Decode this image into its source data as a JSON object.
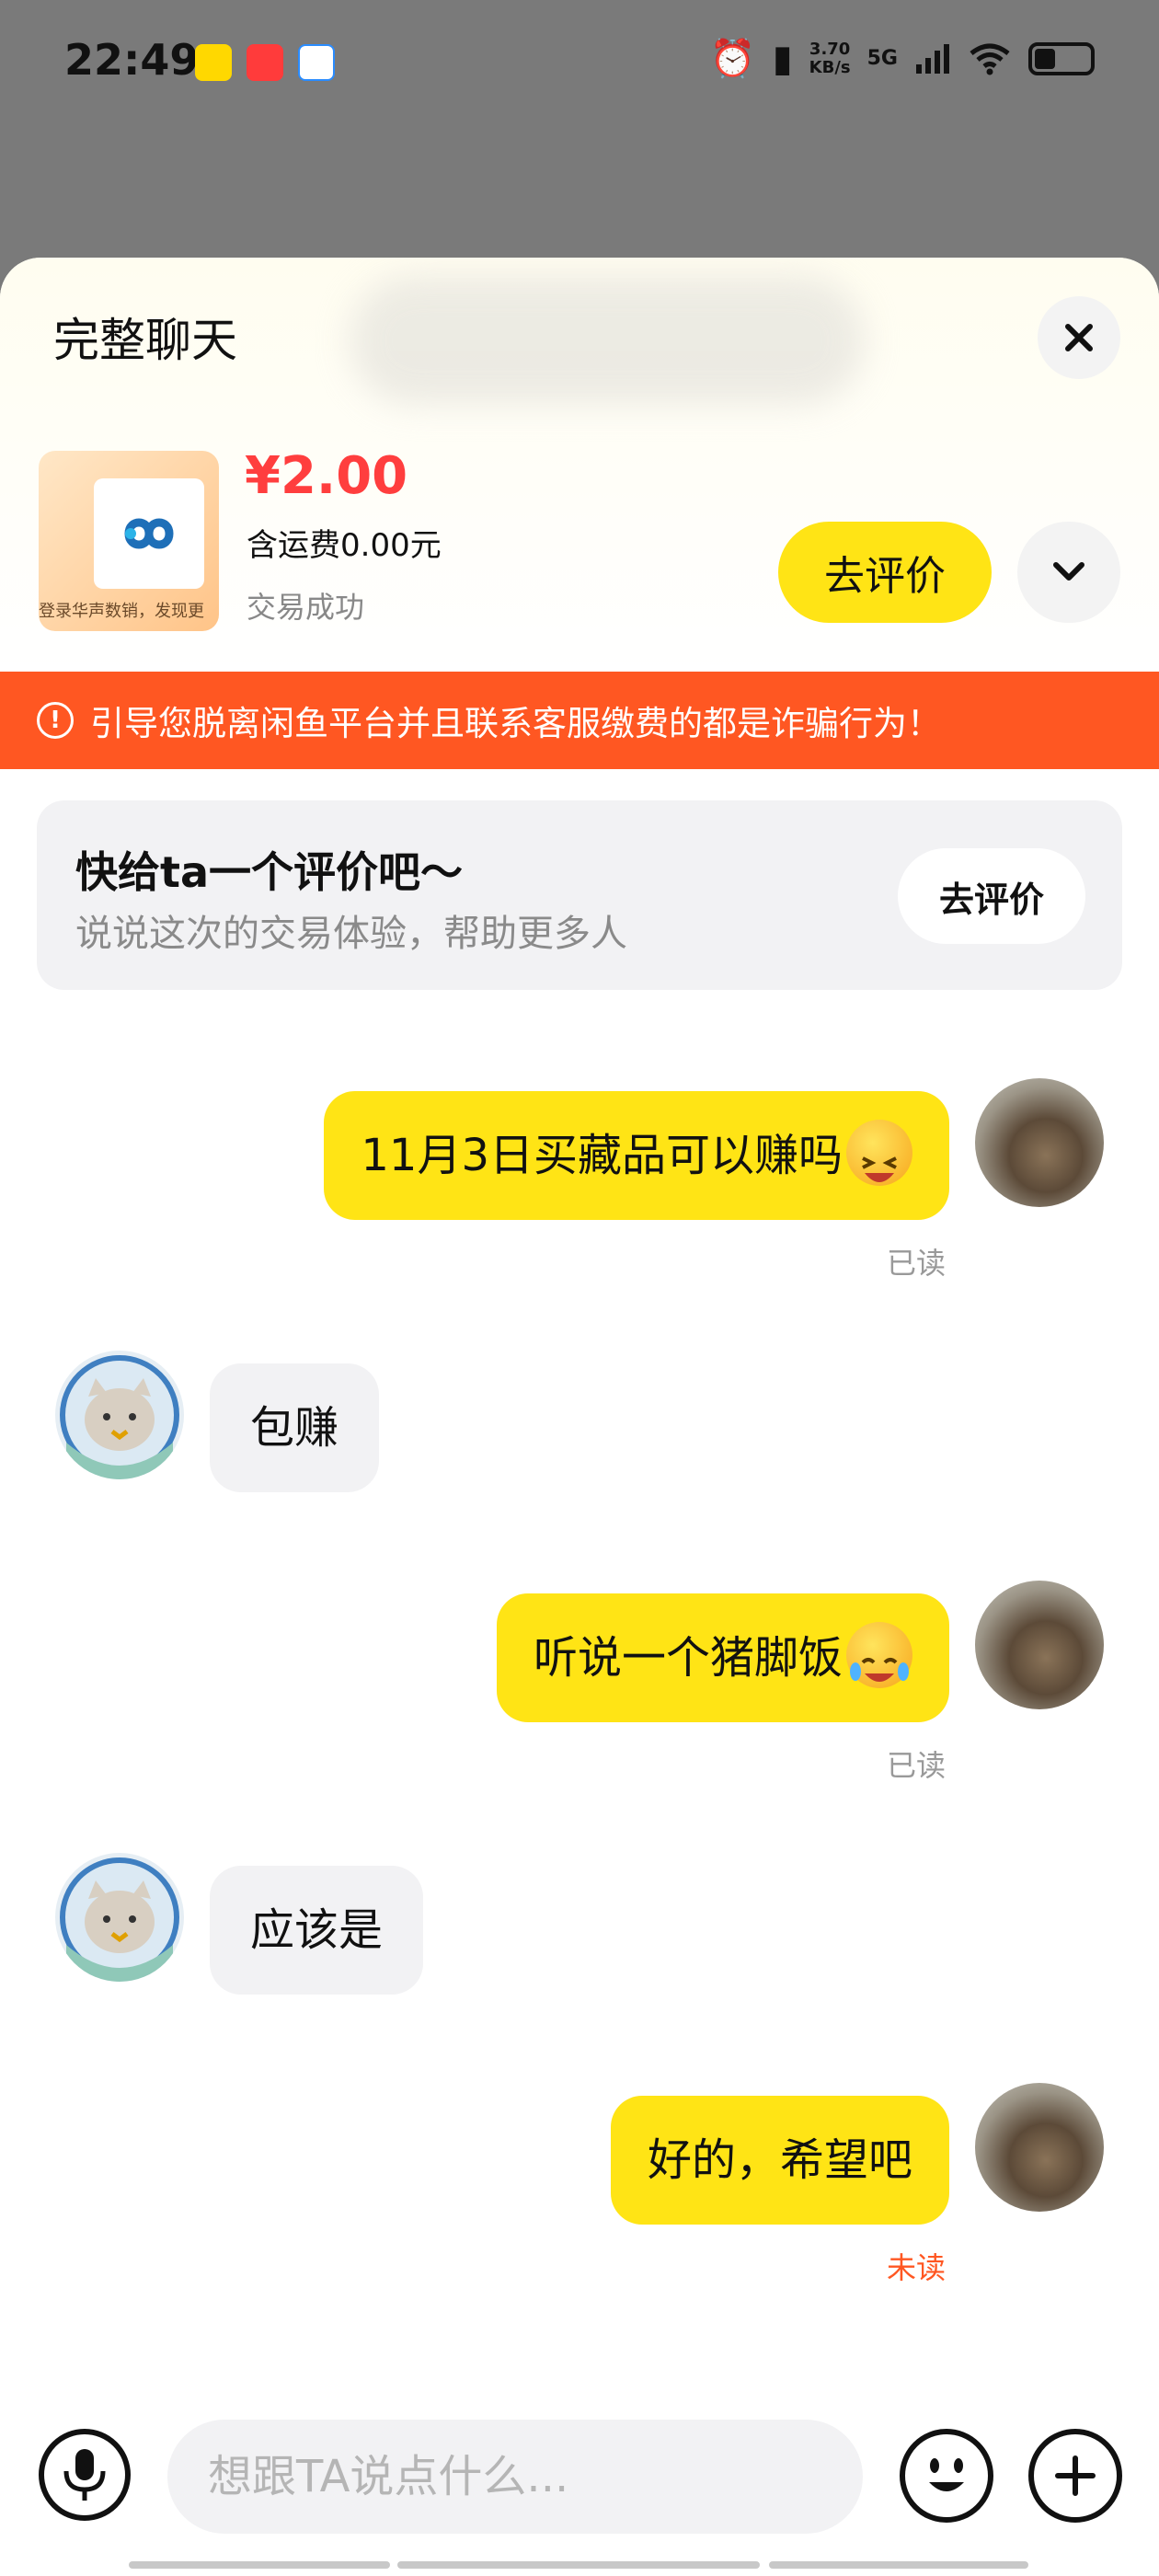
{
  "status_bar": {
    "time": "22:49",
    "net_speed": "3.70",
    "net_speed_unit": "KB/s",
    "network": "5G",
    "battery_level": 0.35,
    "app_icons": [
      "app-icon-yellow",
      "app-icon-red",
      "app-icon-blue"
    ]
  },
  "sheet": {
    "title": "完整聊天",
    "close_icon": "close-icon"
  },
  "product": {
    "thumb_caption": "登录华声数销，发现更",
    "price": "¥2.00",
    "shipping": "含运费0.00元",
    "trade_status": "交易成功",
    "review_button": "去评价",
    "expand_icon": "chevron-down-icon"
  },
  "warning": {
    "icon": "!",
    "text": "引导您脱离闲鱼平台并且联系客服缴费的都是诈骗行为！"
  },
  "review_card": {
    "title": "快给ta一个评价吧～",
    "subtitle": "说说这次的交易体验，帮助更多人",
    "button": "去评价"
  },
  "messages": [
    {
      "from": "me",
      "text": "11月3日买藏品可以赚吗",
      "emoji": "laughing-emoji",
      "status": "已读"
    },
    {
      "from": "ta",
      "text": "包赚"
    },
    {
      "from": "me",
      "text": "听说一个猪脚饭",
      "emoji": "tears-of-joy-emoji",
      "status": "已读"
    },
    {
      "from": "ta",
      "text": "应该是"
    },
    {
      "from": "me",
      "text": "好的，希望吧",
      "status": "未读"
    }
  ],
  "input_bar": {
    "placeholder": "想跟TA说点什么...",
    "mic_icon": "microphone-icon",
    "emoji_icon": "emoji-icon",
    "plus_icon": "plus-icon"
  },
  "colors": {
    "accent_yellow": "#ffe415",
    "price_red": "#ff3e3e",
    "warning_orange": "#ff5722",
    "unread_orange": "#ff5722"
  }
}
